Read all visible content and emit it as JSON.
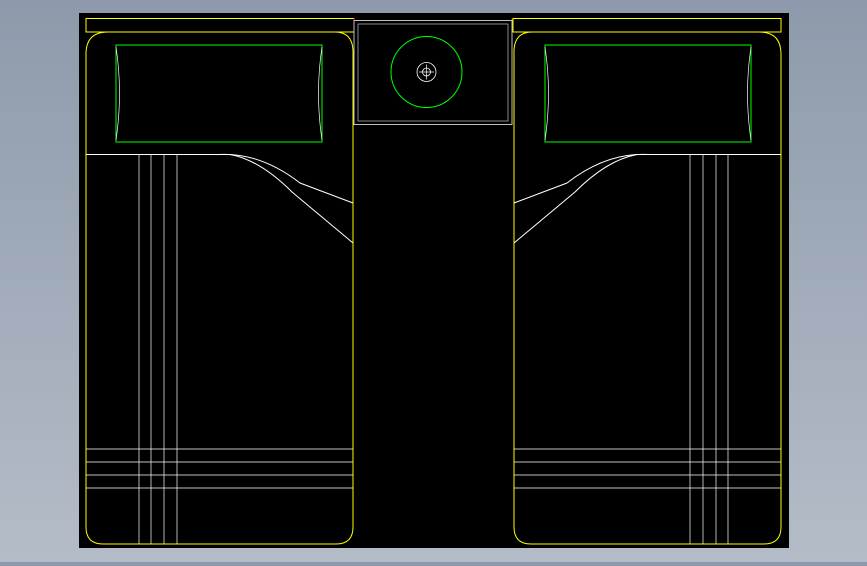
{
  "drawing": {
    "subject": "",
    "colors": {
      "background": "#8e9aab",
      "canvas": "#000000",
      "outline": "#ffff00",
      "pillow": "#00ff00",
      "lamp": "#00ff00",
      "detail": "#ffffff",
      "nightstand": "#c0c0c0",
      "accent": "#ff0000"
    }
  }
}
